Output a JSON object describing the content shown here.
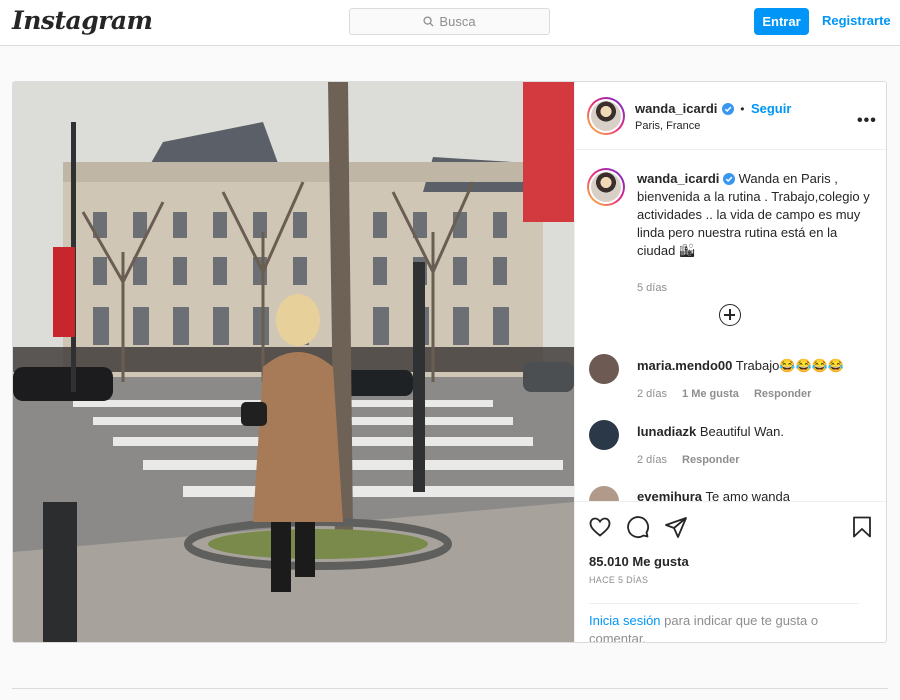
{
  "topbar": {
    "logo": "Instagram",
    "search_placeholder": "Busca",
    "login_label": "Entrar",
    "register_label": "Registrarte"
  },
  "post": {
    "username": "wanda_icardi",
    "follow_label": "Seguir",
    "location": "Paris, France",
    "more_label": "•••",
    "caption": "Wanda en Paris , bienvenida a la rutina . Trabajo,colegio y actividades .. la vida de campo es muy linda pero nuestra rutina está en la ciudad 🏙",
    "caption_time": "5 días",
    "likes": "85.010 Me gusta",
    "time_ago": "HACE 5 DÍAS",
    "login_link": "Inicia sesión",
    "login_rest": "para indicar que te gusta o comentar."
  },
  "comments": [
    {
      "user": "maria.mendo00",
      "text": "Trabajo😂😂😂😂",
      "time": "2 días",
      "likes": "1 Me gusta",
      "reply": "Responder",
      "avatar_color": "#6d5a52"
    },
    {
      "user": "lunadiazk",
      "text": "Beautiful Wan.",
      "time": "2 días",
      "likes": "",
      "reply": "Responder",
      "avatar_color": "#2b3848"
    },
    {
      "user": "evemihura",
      "text": "Te amo wanda",
      "time": "",
      "likes": "",
      "reply": "",
      "avatar_color": "#b29a8a"
    }
  ],
  "colors": {
    "accent": "#0095f6",
    "border": "#dbdbdb",
    "text": "#262626",
    "muted": "#8e8e8e"
  },
  "icons": [
    "search-icon",
    "verified-badge-icon",
    "more-options-icon",
    "add-comments-icon",
    "heart-icon",
    "comment-icon",
    "share-icon",
    "bookmark-icon"
  ]
}
